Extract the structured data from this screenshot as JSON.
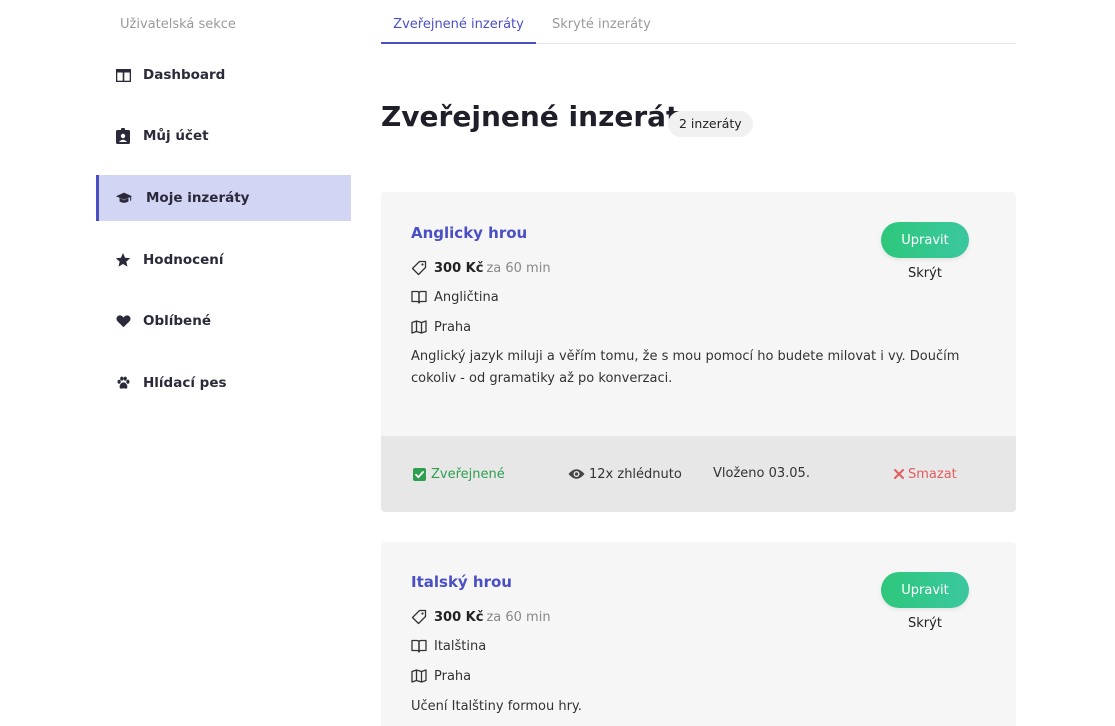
{
  "sidebar": {
    "title": "Uživatelská sekce",
    "items": [
      {
        "label": "Dashboard",
        "icon": "dashboard-icon"
      },
      {
        "label": "Můj účet",
        "icon": "id-badge-icon"
      },
      {
        "label": "Moje inzeráty",
        "icon": "graduation-cap-icon",
        "active": true
      },
      {
        "label": "Hodnocení",
        "icon": "star-icon"
      },
      {
        "label": "Oblíbené",
        "icon": "heart-icon"
      },
      {
        "label": "Hlídací pes",
        "icon": "paw-icon"
      }
    ]
  },
  "tabs": [
    {
      "label": "Zveřejnené inzeráty",
      "active": true
    },
    {
      "label": "Skryté inzeráty",
      "active": false
    }
  ],
  "header": {
    "title": "Zveřejnené inzeráty",
    "count_badge": "2 inzeráty"
  },
  "ads": [
    {
      "title": "Anglicky hrou",
      "price": "300 Kč",
      "per": "za 60 min",
      "subject": "Angličtina",
      "city": "Praha",
      "description": "Anglický jazyk miluji a věřím tomu, že s mou pomocí ho budete milovat i vy. Doučím cokoliv - od gramatiky až po konverzaci.",
      "edit_label": "Upravit",
      "hide_label": "Skrýt",
      "status": "Zveřejnené",
      "views": "12x zhlédnuto",
      "posted": "Vloženo 03.05.",
      "delete_label": "Smazat"
    },
    {
      "title": "Italský hrou",
      "price": "300 Kč",
      "per": "za 60 min",
      "subject": "Italština",
      "city": "Praha",
      "description": "Učení Italštiny formou hry.",
      "edit_label": "Upravit",
      "hide_label": "Skrýt"
    }
  ],
  "colors": {
    "accent": "#4a4fc4",
    "active_nav_bg": "#d3d5f5",
    "button_green": "#2dc77b",
    "status_green": "#2e9e4f",
    "delete_red": "#e35d5d"
  }
}
